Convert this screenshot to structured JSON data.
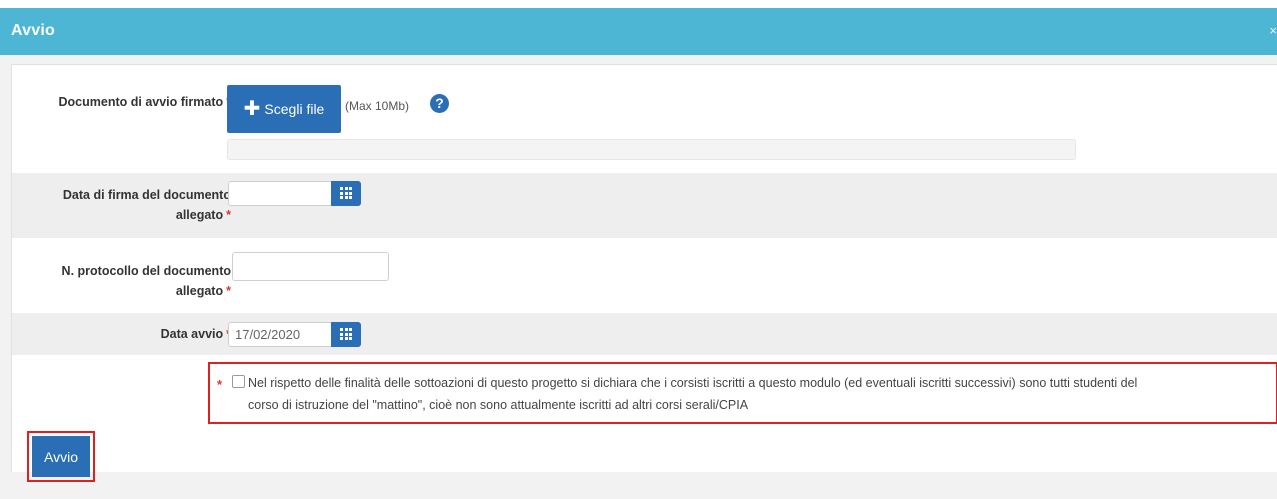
{
  "header": {
    "title": "Avvio",
    "close_symbol": "×"
  },
  "form": {
    "documento": {
      "label": "Documento di avvio firmato",
      "required_mark": "*",
      "button_icon": "plus-icon",
      "button_label": "Scegli file",
      "max_size": "(Max 10Mb)",
      "help_icon": "question-circle-icon",
      "help_symbol": "?"
    },
    "data_firma": {
      "label_line1": "Data di firma del documento",
      "label_line2": "allegato",
      "required_mark": "*",
      "value": "",
      "calendar_icon": "calendar-icon"
    },
    "protocollo": {
      "label_line1": "N. protocollo del documento",
      "label_line2": "allegato",
      "required_mark": "*",
      "value": ""
    },
    "data_avvio": {
      "label": "Data avvio",
      "required_mark": "*",
      "value": "17/02/2020",
      "calendar_icon": "calendar-icon"
    },
    "dichiarazione": {
      "required_mark": "*",
      "checked": false,
      "text_line1": "Nel rispetto delle finalità delle sottoazioni di questo progetto si dichiara che i corsisti iscritti a questo modulo (ed eventuali iscritti successivi) sono tutti studenti del",
      "text_line2": "corso di istruzione del \"mattino\", cioè non sono attualmente iscritti ad altri corsi serali/CPIA"
    },
    "submit_label": "Avvio"
  },
  "colors": {
    "header": "#4db6d4",
    "primary_button": "#2a6fb5",
    "required": "#e0362b",
    "highlight_border": "#e02020"
  }
}
